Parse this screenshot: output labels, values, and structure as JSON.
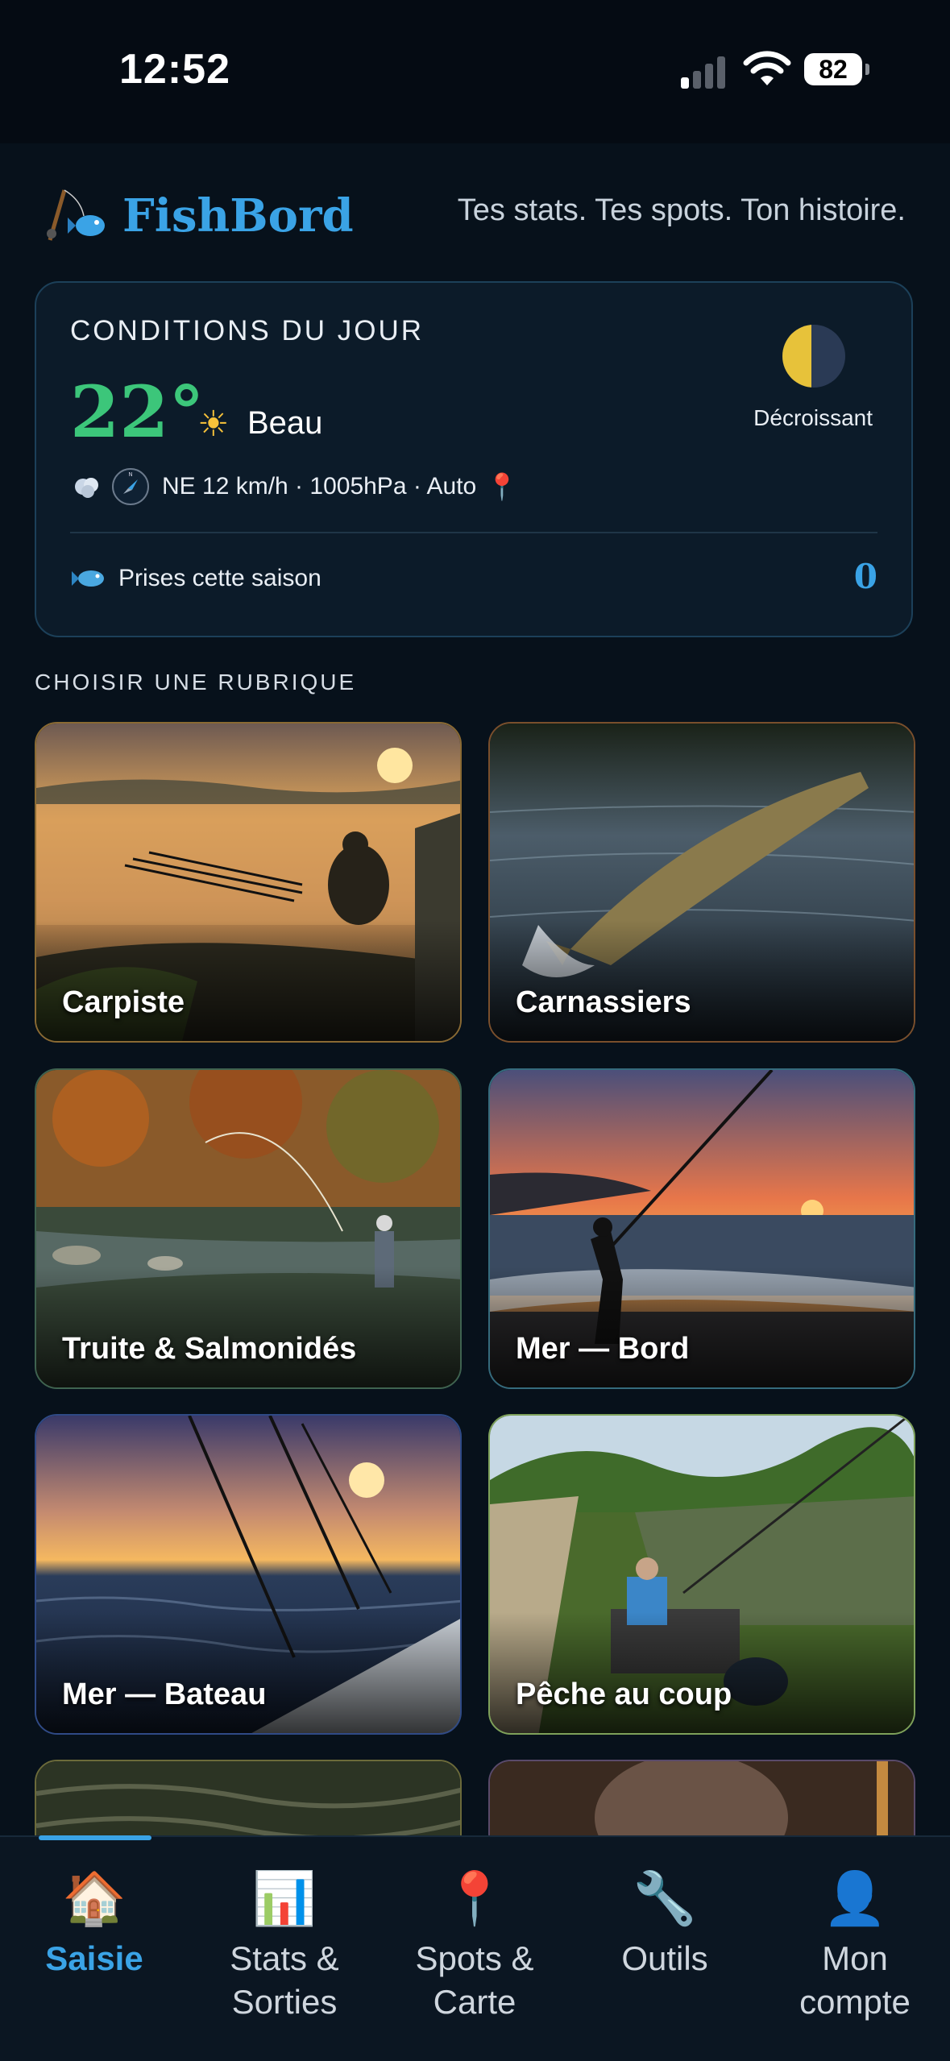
{
  "status_bar": {
    "time": "12:52",
    "battery": "82"
  },
  "app": {
    "name": "FishBord",
    "tagline": "Tes stats. Tes spots. Ton histoire."
  },
  "conditions": {
    "title": "CONDITIONS DU JOUR",
    "temperature": "22°",
    "weather_icon": "sun-icon",
    "weather": "Beau",
    "wind_pressure": "NE 12 km/h · 1005hPa · Auto",
    "moon_phase": "Décroissant",
    "catches_label": "Prises cette saison",
    "catches_count": "0"
  },
  "section_title": "CHOISIR UNE RUBRIQUE",
  "categories": [
    {
      "label": "Carpiste",
      "border": "#8a6a33"
    },
    {
      "label": "Carnassiers",
      "border": "#7a4f2c"
    },
    {
      "label": "Truite & Salmonidés",
      "border": "#3f6350"
    },
    {
      "label": "Mer — Bord",
      "border": "#356b7d"
    },
    {
      "label": "Mer — Bateau",
      "border": "#2f4a86"
    },
    {
      "label": "Pêche au coup",
      "border": "#7ea15a"
    }
  ],
  "bottom_nav": [
    {
      "label": "Saisie",
      "icon": "house-icon",
      "active": true
    },
    {
      "label": "Stats & Sorties",
      "icon": "chart-icon"
    },
    {
      "label": "Spots & Carte",
      "icon": "pin-icon"
    },
    {
      "label": "Outils",
      "icon": "wrench-icon"
    },
    {
      "label": "Mon compte",
      "icon": "user-icon"
    }
  ]
}
